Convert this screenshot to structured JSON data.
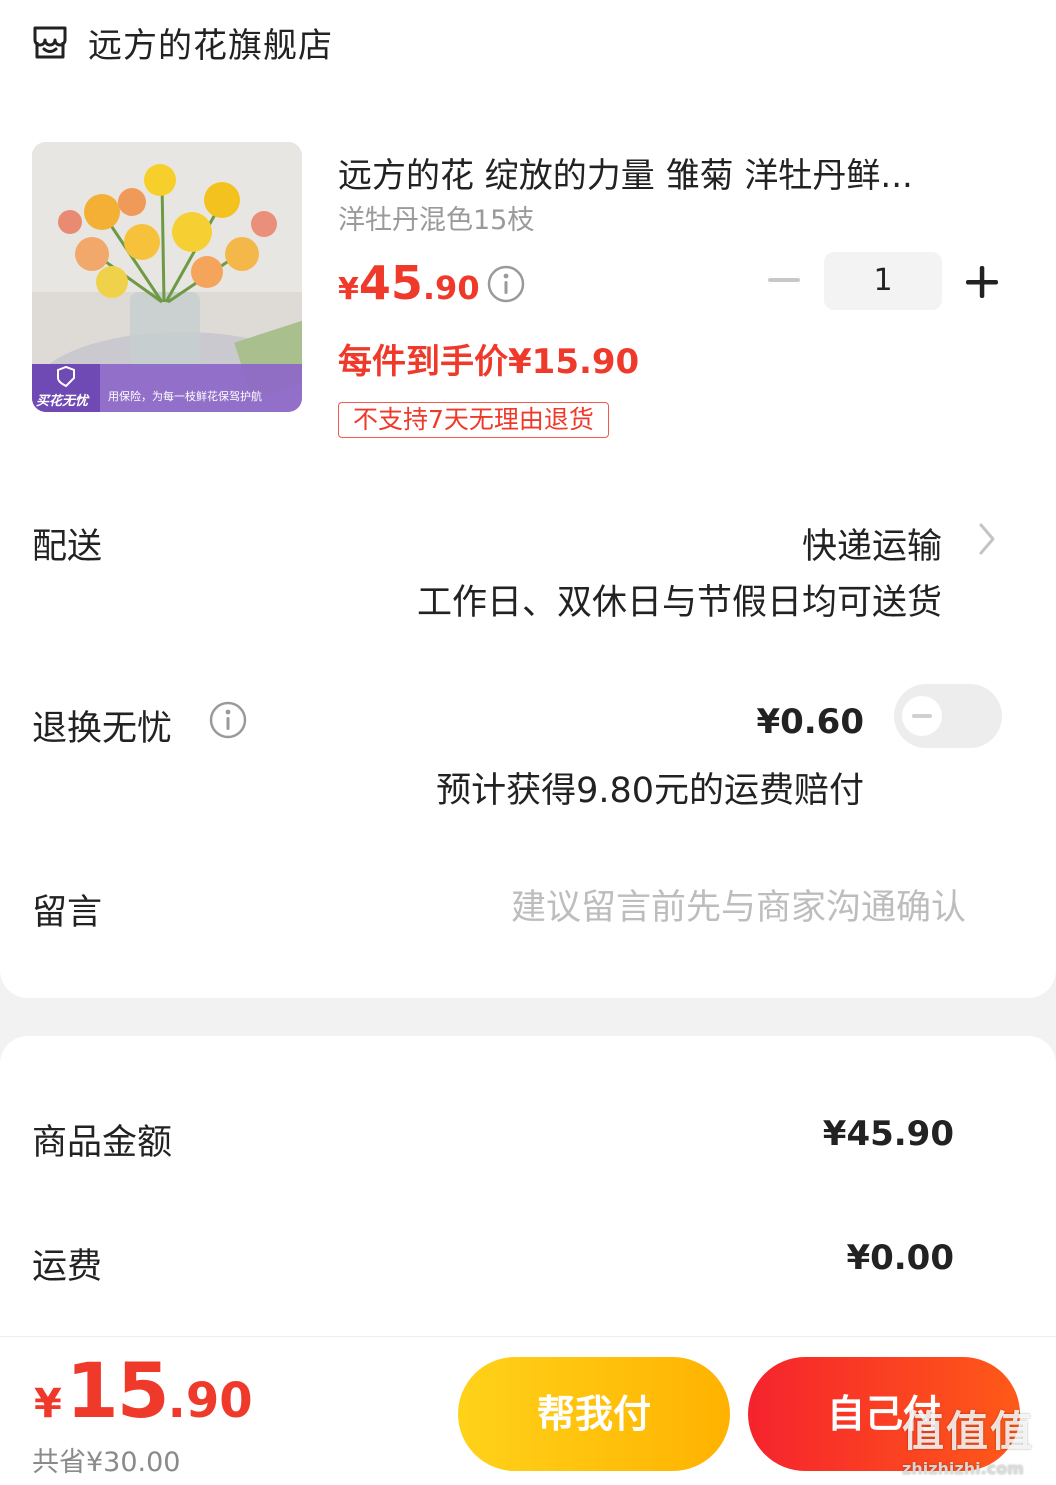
{
  "store": {
    "name": "远方的花旗舰店",
    "icon": "store-icon"
  },
  "product": {
    "title": "远方的花 绽放的力量 雏菊 洋牡丹鲜...",
    "spec": "洋牡丹混色15枝",
    "price_currency": "¥",
    "price_int": "45",
    "price_dec": ".90",
    "deal_price": "每件到手价¥15.90",
    "tag": "不支持7天无理由退货",
    "quantity": "1",
    "image_badge": "买花无忧",
    "image_banner": "用保险，为每一枝鲜花保驾护航"
  },
  "delivery": {
    "label": "配送",
    "value": "快递运输",
    "sub": "工作日、双休日与节假日均可送货"
  },
  "insurance": {
    "label": "退换无忧",
    "price": "¥0.60",
    "sub": "预计获得9.80元的运费赔付",
    "enabled": false
  },
  "message": {
    "label": "留言",
    "placeholder": "建议留言前先与商家沟通确认",
    "value": ""
  },
  "summary": {
    "goods_label": "商品金额",
    "goods_value": "¥45.90",
    "shipping_label": "运费",
    "shipping_value": "¥0.00"
  },
  "footer": {
    "total_currency": "¥",
    "total_int": "15",
    "total_dec": ".90",
    "saved": "共省¥30.00",
    "help_pay_label": "帮我付",
    "self_pay_label": "自己付"
  },
  "watermark": {
    "logo": "值值值",
    "url": "zhizhizhi.com"
  },
  "colors": {
    "accent_red": "#ef3a2b",
    "help_btn": "#ffc400",
    "self_btn": "#f5232d"
  }
}
